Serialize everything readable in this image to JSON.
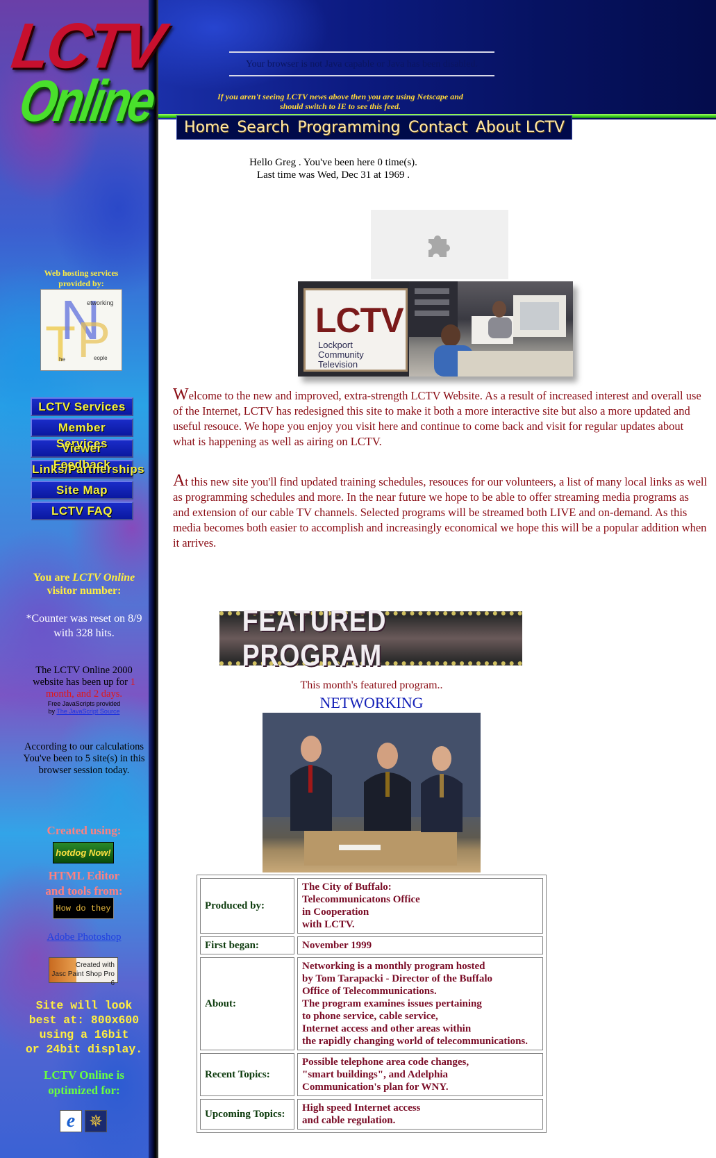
{
  "logo": {
    "line1": "LCTV",
    "line2": "Online"
  },
  "applet": {
    "java_message": "Your browser is not Java capable or Java has been disabled.",
    "netscape_notice_line1": "If you aren't seeing LCTV news above then you are using Netscape and",
    "netscape_notice_line2": "should switch to IE to see this feed."
  },
  "nav": {
    "home": "Home",
    "search": "Search",
    "programming": "Programming",
    "contact": "Contact",
    "about": "About LCTV"
  },
  "greeting": {
    "line1": "Hello Greg . You've been here 0 time(s).",
    "line2": "Last time was Wed, Dec 31 at 1969 ."
  },
  "banner_image": {
    "sign_title": "LCTV",
    "sign_line1": "Lockport",
    "sign_line2": "Community",
    "sign_line3": "Television"
  },
  "welcome": {
    "p1_cap": "W",
    "p1_text": "elcome to the new and improved, extra-strength LCTV Website. As a result of increased interest and overall use of the Internet, LCTV has redesigned this site to make it both a more interactive site but also a more updated and useful resouce. We hope you enjoy you visit here and continue to come back and visit for regular updates about what is happening as well as airing on LCTV.",
    "p2_cap": "A",
    "p2_text": "t this new site you'll find updated training schedules, resouces for our volunteers, a list of many local links as well as programming schedules and more. In the near future we hope to be able to offer streaming media programs as and extension of our cable TV channels. Selected programs will be streamed both LIVE and on-demand. As this media becomes both easier to accomplish and increasingly economical we hope this will be a popular addition when it arrives."
  },
  "featured": {
    "banner": "FEATURED PROGRAM",
    "intro": "This month's featured program..",
    "name": "NETWORKING"
  },
  "program_table": [
    {
      "key": "Produced by:",
      "value": [
        "The City of Buffalo:",
        "Telecommunicatons Office",
        "in Cooperation",
        "with LCTV."
      ]
    },
    {
      "key": "First began:",
      "value": [
        "November 1999"
      ]
    },
    {
      "key": "About:",
      "value": [
        "Networking is a monthly program hosted",
        "by Tom Tarapacki - Director of the Buffalo",
        "Office of Telecommunications.",
        "The program examines issues pertaining",
        "to phone service, cable service,",
        "Internet access and other areas within",
        "the rapidly changing world of telecommunications."
      ]
    },
    {
      "key": "Recent Topics:",
      "value": [
        "Possible telephone area code changes,",
        "\"smart buildings\", and Adelphia",
        "Communication's plan for WNY."
      ]
    },
    {
      "key": "Upcoming Topics:",
      "value": [
        "High speed Internet access",
        "and cable regulation."
      ]
    }
  ],
  "sidebar": {
    "hosting_line1": "Web hosting services",
    "hosting_line2": "provided by:",
    "tnp_logo": {
      "t": "T",
      "n": "N",
      "p": "P",
      "networking": "etworking",
      "the": "he",
      "people": "eople"
    },
    "menu": [
      "LCTV Services",
      "Member Services",
      "Viewer Feedback",
      "Links/Partnerships",
      "Site Map",
      "LCTV FAQ"
    ],
    "visitor_prefix": "You are",
    "visitor_site": "LCTV Online",
    "visitor_suffix": "visitor number:",
    "counter_reset": "*Counter was reset on 8/9 with 328 hits.",
    "uptime_line1": "The LCTV Online 2000 website has been up for",
    "uptime_value": "1 month, and 2 days.",
    "js_credit": "Free JavaScripts provided",
    "js_by": "by",
    "js_source": "The JavaScript Source",
    "calc_line1": "According to our calculations",
    "calc_line2": "You've been to 5 site(s) in this browser session today.",
    "created_using": "Created using:",
    "hotdog_button": "hotdog Now!",
    "html_editor_line1": "HTML Editor",
    "html_editor_line2": "and tools from:",
    "howdo_button": "How do they",
    "photoshop_link": "Adobe Photoshop",
    "psp_line1": "Created with",
    "psp_line2": "Jasc Paint Shop Pro 6",
    "best_view_line1": "Site will look",
    "best_view_line2": "best at: 800x600",
    "best_view_line3": "using a 16bit",
    "best_view_line4": "or 24bit display.",
    "optimized_line1": "LCTV Online is",
    "optimized_line2": "optimized for:",
    "ie_icon": "e",
    "ns_icon": "✵"
  }
}
